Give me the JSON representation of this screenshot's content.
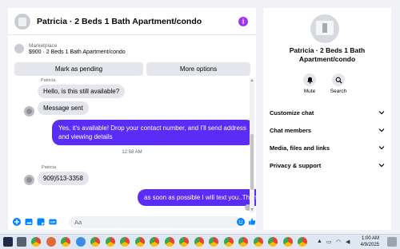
{
  "header": {
    "title": "Patricia · 2 Beds 1 Bath Apartment/condo",
    "info_icon": "info-icon"
  },
  "marketplace": {
    "label": "Marketplace",
    "description": "$900 · 2 Beds 1 Bath Apartment/condo"
  },
  "actions": {
    "pending_label": "Mark as pending",
    "more_label": "More options"
  },
  "thread": {
    "sender_top": "Patricia",
    "msg_available": "Hello, is this still available?",
    "msg_sent": "Message sent",
    "msg_reply": "Yes, it's available! Drop your contact number, and I'll send address and viewing details",
    "timestamp": "12:58 AM",
    "sender_name": "Patricia",
    "msg_phone": "909)513-3358",
    "msg_last": "as soon as possible I will text you..Thanks"
  },
  "composer": {
    "placeholder": "Aa"
  },
  "info_panel": {
    "title": "Patricia · 2 Beds 1 Bath Apartment/condo",
    "mute_label": "Mute",
    "search_label": "Search",
    "menu": [
      {
        "label": "Customize chat"
      },
      {
        "label": "Chat members"
      },
      {
        "label": "Media, files and links"
      },
      {
        "label": "Privacy & support"
      }
    ]
  },
  "taskbar": {
    "time": "1:00 AM",
    "date": "4/9/2025"
  },
  "colors": {
    "accent": "#5b2cf6",
    "messenger_blue": "#0084ff",
    "info_purple": "#a033ff"
  }
}
